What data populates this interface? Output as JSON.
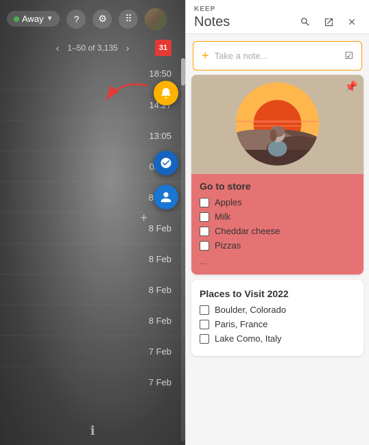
{
  "left": {
    "status": "Away",
    "pagination": "1–50 of 3,135",
    "nav_prev": "‹",
    "nav_next": "›",
    "times": [
      "18:50",
      "14:27",
      "13:05",
      "05:10",
      "8 Feb",
      "8 Feb",
      "8 Feb",
      "8 Feb",
      "8 Feb",
      "7 Feb",
      "7 Feb"
    ],
    "info_icon": "ℹ"
  },
  "right": {
    "app_label": "KEEP",
    "app_title": "Notes",
    "search_icon": "🔍",
    "open_icon": "⬡",
    "close_icon": "✕",
    "note_input_placeholder": "Take a note...",
    "note_plus": "+",
    "note_checkbox": "☑",
    "note1": {
      "pin": "📌",
      "title": "Go to store",
      "items": [
        "Apples",
        "Milk",
        "Cheddar cheese",
        "Pizzas"
      ],
      "ellipsis": "..."
    },
    "note2": {
      "title": "Places to Visit 2022",
      "items": [
        "Boulder, Colorado",
        "Paris, France",
        "Lake Como, Italy"
      ]
    }
  }
}
